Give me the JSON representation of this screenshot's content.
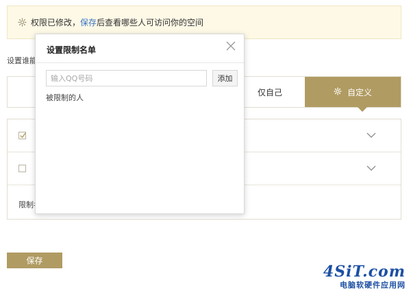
{
  "notice": {
    "prefix": "权限已修改，",
    "link": "保存",
    "suffix": "后查看哪些人可访问你的空间"
  },
  "section_label": "设置谁能访",
  "permissions": {
    "only_me": "仅自己",
    "custom": "自定义"
  },
  "list": {
    "rows": [
      {
        "checked": true
      },
      {
        "checked": false
      }
    ],
    "restrict_label": "限制名"
  },
  "save_button": "保存",
  "modal": {
    "title": "设置限制名单",
    "input_placeholder": "输入QQ号码",
    "add_button": "添加",
    "restricted_label": "被限制的人"
  },
  "watermark": {
    "logo": "4SiT.com",
    "sub": "电脑软硬件应用网"
  },
  "colors": {
    "accent": "#b09b62",
    "notice_bg": "#fdf9e6",
    "link": "#3a75c4"
  }
}
